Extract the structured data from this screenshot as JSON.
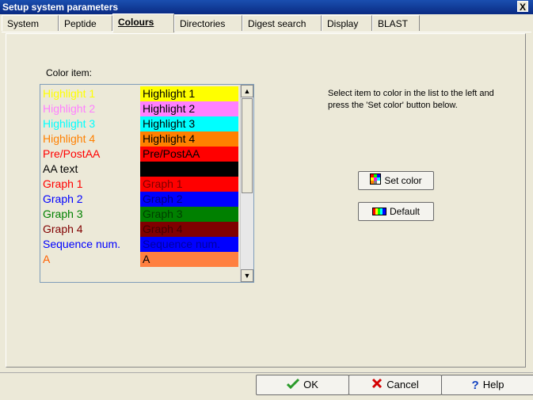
{
  "window": {
    "title": "Setup system parameters",
    "close_glyph": "X"
  },
  "tabs": [
    {
      "label": "System"
    },
    {
      "label": "Peptide"
    },
    {
      "label": "Colours"
    },
    {
      "label": "Directories"
    },
    {
      "label": "Digest search"
    },
    {
      "label": "Display"
    },
    {
      "label": "BLAST"
    }
  ],
  "active_tab": "Colours",
  "color_item_label": "Color item:",
  "color_items": [
    {
      "name": "Highlight 1",
      "swatch_text": "Highlight 1",
      "name_color": "#ffff00",
      "bg": "#ffff00",
      "fg": "#000000"
    },
    {
      "name": "Highlight 2",
      "swatch_text": "Highlight 2",
      "name_color": "#ff80ff",
      "bg": "#ff80ff",
      "fg": "#000000"
    },
    {
      "name": "Highlight 3",
      "swatch_text": "Highlight 3",
      "name_color": "#00ffff",
      "bg": "#00ffff",
      "fg": "#000000"
    },
    {
      "name": "Highlight 4",
      "swatch_text": "Highlight 4",
      "name_color": "#ff8000",
      "bg": "#ff8000",
      "fg": "#000000"
    },
    {
      "name": "Pre/PostAA",
      "swatch_text": "Pre/PostAA",
      "name_color": "#ff0000",
      "bg": "#ff0000",
      "fg": "#000000"
    },
    {
      "name": "AA text",
      "swatch_text": "",
      "name_color": "#000000",
      "bg": "#000000",
      "fg": "#000000"
    },
    {
      "name": "Graph 1",
      "swatch_text": "Graph 1",
      "name_color": "#ff0000",
      "bg": "#ff0000",
      "fg": "#800000"
    },
    {
      "name": "Graph 2",
      "swatch_text": "Graph 2",
      "name_color": "#0000ff",
      "bg": "#0000ff",
      "fg": "#000080"
    },
    {
      "name": "Graph 3",
      "swatch_text": "Graph 3",
      "name_color": "#008000",
      "bg": "#008000",
      "fg": "#004000"
    },
    {
      "name": "Graph 4",
      "swatch_text": "Graph 4",
      "name_color": "#800000",
      "bg": "#800000",
      "fg": "#400000"
    },
    {
      "name": "Sequence num.",
      "swatch_text": "Sequence num.",
      "name_color": "#0000ff",
      "bg": "#0000ff",
      "fg": "#0000a0"
    },
    {
      "name": "A",
      "swatch_text": "A",
      "name_color": "#ff6000",
      "bg": "#ff8040",
      "fg": "#000000"
    }
  ],
  "instructions": "Select item to color in the list to the left and press the 'Set color' button below.",
  "buttons": {
    "set_color": "Set color",
    "default": "Default",
    "ok": "OK",
    "cancel": "Cancel",
    "help": "Help"
  },
  "icons": [
    "color-grid-icon",
    "color-bar-icon",
    "checkmark-icon",
    "cross-icon",
    "question-icon",
    "scroll-up-icon",
    "scroll-down-icon"
  ]
}
